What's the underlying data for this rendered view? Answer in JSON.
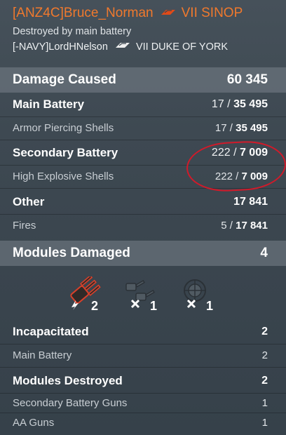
{
  "header": {
    "player": "[ANZ4C]Bruce_Norman",
    "ship": "VII SINOP",
    "cause": "Destroyed by main battery",
    "killer": "[-NAVY]LordHNelson",
    "killer_ship": "VII DUKE OF YORK"
  },
  "damage": {
    "title": "Damage Caused",
    "total": "60 345",
    "main_battery": {
      "label": "Main Battery",
      "hits": "17 / ",
      "damage": "35 495"
    },
    "ap_shells": {
      "label": "Armor Piercing Shells",
      "hits": "17 / ",
      "damage": "35 495"
    },
    "secondary_battery": {
      "label": "Secondary Battery",
      "hits": "222 / ",
      "damage": "7 009"
    },
    "he_shells": {
      "label": "High Explosive Shells",
      "hits": "222 / ",
      "damage": "7 009"
    },
    "other": {
      "label": "Other",
      "damage": "17 841"
    },
    "fires": {
      "label": "Fires",
      "hits": "5 / ",
      "damage": "17 841"
    }
  },
  "modules": {
    "title": "Modules Damaged",
    "total": "4",
    "icons": [
      {
        "name": "main-battery-module-icon",
        "count": "2"
      },
      {
        "name": "secondary-guns-module-icon",
        "count": "1"
      },
      {
        "name": "aa-guns-module-icon",
        "count": "1"
      }
    ],
    "incapacitated": {
      "label": "Incapacitated",
      "value": "2"
    },
    "main_battery": {
      "label": "Main Battery",
      "value": "2"
    },
    "destroyed": {
      "label": "Modules Destroyed",
      "value": "2"
    },
    "secondary_guns": {
      "label": "Secondary Battery Guns",
      "value": "1"
    },
    "aa_guns": {
      "label": "AA Guns",
      "value": "1"
    }
  },
  "colors": {
    "accent": "#f0792d",
    "annotation": "#d11a2a"
  }
}
